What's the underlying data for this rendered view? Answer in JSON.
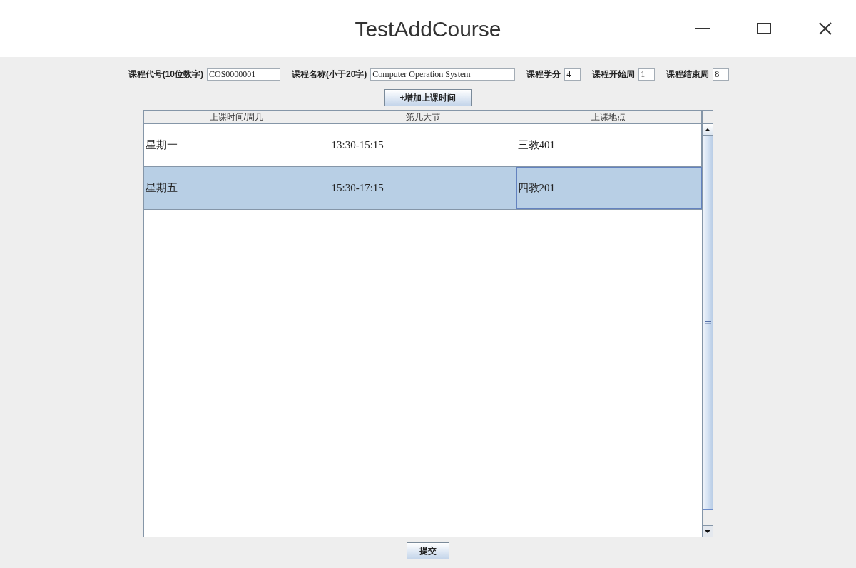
{
  "window": {
    "title": "TestAddCourse"
  },
  "form_fields": [
    {
      "label": "课程代号(10位数字)",
      "value": "COS0000001"
    },
    {
      "label": "课程名称(小于20字)",
      "value": "Computer Operation System"
    },
    {
      "label": "课程学分",
      "value": "4"
    },
    {
      "label": "课程开始周",
      "value": "1"
    },
    {
      "label": "课程结束周",
      "value": "8"
    }
  ],
  "add_time_button": {
    "label": "+增加上课时间"
  },
  "table": {
    "columns": [
      "上课时间/周几",
      "第几大节",
      "上课地点"
    ],
    "rows": [
      {
        "selected": false,
        "cells": [
          {
            "text": "星期一",
            "focused": false
          },
          {
            "text": "13:30-15:15",
            "focused": false
          },
          {
            "text": "三教401",
            "focused": false
          }
        ]
      },
      {
        "selected": true,
        "cells": [
          {
            "text": "星期五",
            "focused": false
          },
          {
            "text": "15:30-17:15",
            "focused": false
          },
          {
            "text": "四教201",
            "focused": true
          }
        ]
      }
    ]
  },
  "submit_button": {
    "label": "提交"
  }
}
